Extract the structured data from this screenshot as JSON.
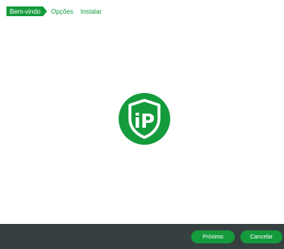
{
  "breadcrumb": {
    "steps": [
      {
        "label": "Bem-vindo",
        "active": true
      },
      {
        "label": "Opções",
        "active": false
      },
      {
        "label": "Instalar",
        "active": false
      }
    ]
  },
  "logo": {
    "icon": "ip-shield-icon",
    "text": "iP",
    "color": "#139b3c"
  },
  "footer": {
    "next_label": "Próximo",
    "cancel_label": "Cancelar"
  },
  "colors": {
    "accent": "#139b3c",
    "footer_bg": "#374040",
    "background": "#ffffff"
  }
}
